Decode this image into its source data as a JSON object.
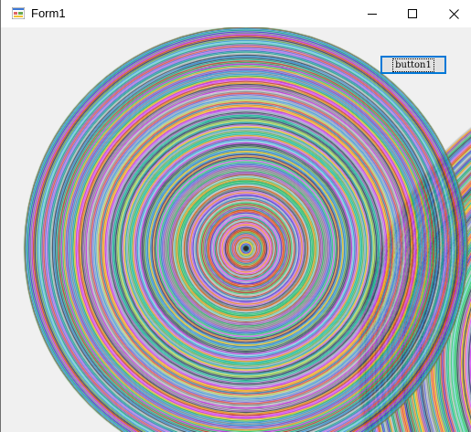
{
  "window": {
    "title": "Form1",
    "icon": "winforms-app-icon",
    "caption_buttons": [
      "minimize-icon",
      "maximize-icon",
      "close-icon"
    ]
  },
  "form": {
    "button_label": "button1",
    "canvas": "concentric-circles-drawing"
  },
  "colors": {
    "client_background": "#f0f0f0",
    "button_border": "#0078d7",
    "button_face": "#e1e1e1",
    "palette": [
      "#c0392b",
      "#27ae60",
      "#2980b9",
      "#8e44ad",
      "#f1c40f",
      "#16a085",
      "#e67e22",
      "#7f8c8d",
      "#2c3e50",
      "#d35400",
      "#1abc9c",
      "#9b59b6",
      "#3498db",
      "#e74c3c",
      "#2ecc71",
      "#bdc3c7",
      "#34495e",
      "#f39c12",
      "#c471ed",
      "#6ab04c",
      "#eb4d4b",
      "#4834d4",
      "#22a6b3",
      "#be2edd",
      "#f0932b",
      "#badc58",
      "#7ed6df",
      "#e056fd",
      "#686de0",
      "#30336b",
      "#95afc0",
      "#a0522d"
    ]
  }
}
